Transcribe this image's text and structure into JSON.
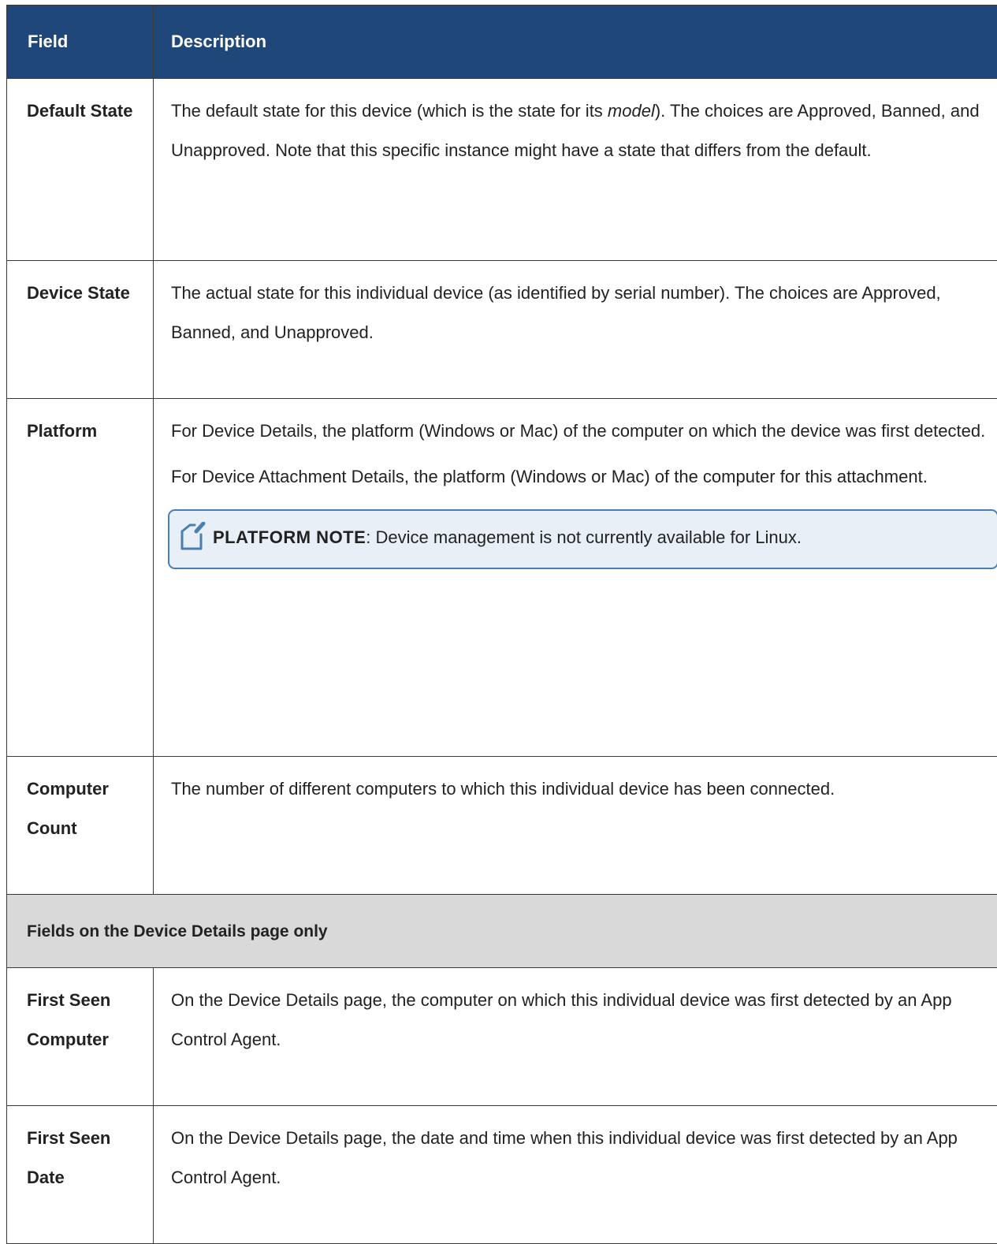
{
  "table": {
    "headers": {
      "field": "Field",
      "description": "Description"
    },
    "rows": [
      {
        "field": "Default State",
        "desc_before_em": "The default state for this device (which is the state for its ",
        "desc_em": "model",
        "desc_after_em": "). The choices are Approved, Banned, and Unapproved. Note that this specific instance might have a state that differs from the default."
      },
      {
        "field": "Device State",
        "description": "The actual state for this individual device (as identified by serial number). The choices are Approved, Banned, and Unapproved."
      },
      {
        "field": "Platform",
        "paragraphs": [
          "For Device Details, the platform (Windows or Mac) of the computer on which the device was first detected.",
          "For Device Attachment Details, the platform (Windows or Mac) of the computer for this attachment."
        ],
        "note": {
          "icon": "note-pencil-icon",
          "label": "PLATFORM NOTE",
          "text": ": Device management is not currently available for Linux."
        }
      },
      {
        "field": "Computer Count",
        "description": "The number of different computers to which this individual device has been connected."
      }
    ],
    "section_title": "Fields on the Device Details page only",
    "section_rows": [
      {
        "field": "First Seen Computer",
        "description": "On the Device Details page, the computer on which this individual device was first detected by an App Control Agent."
      },
      {
        "field": "First Seen Date",
        "description": "On the Device Details page, the date and time when this individual device was first detected by an App Control Agent."
      }
    ]
  },
  "colors": {
    "header_bg": "#20477a",
    "section_bg": "#d9d9d9",
    "note_border": "#4a7fb4",
    "note_bg": "#e8eff6"
  }
}
